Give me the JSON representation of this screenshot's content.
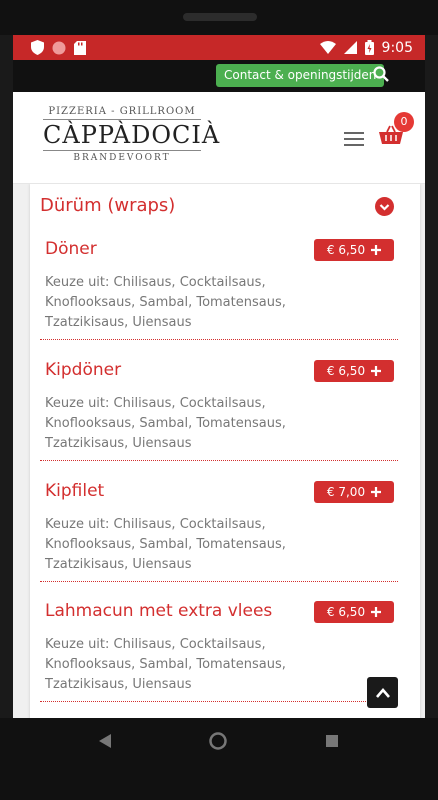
{
  "status_bar": {
    "time": "9:05"
  },
  "top_bar": {
    "contact_label": "Contact & openingstijden"
  },
  "logo": {
    "top": "PIZZERIA - GRILLROOM",
    "main": "CÀPPÀDOCIÀ",
    "bottom": "BRANDEVOORT"
  },
  "cart": {
    "count": "0"
  },
  "category": {
    "title": "Dürüm (wraps)"
  },
  "items": [
    {
      "name": "Döner",
      "price": "€ 6,50",
      "desc": "Keuze uit: Chilisaus, Cocktailsaus, Knoflooksaus, Sambal, Tomatensaus, Tzatzikisaus, Uiensaus"
    },
    {
      "name": "Kipdöner",
      "price": "€ 6,50",
      "desc": "Keuze uit: Chilisaus, Cocktailsaus, Knoflooksaus, Sambal, Tomatensaus, Tzatzikisaus, Uiensaus"
    },
    {
      "name": "Kipfilet",
      "price": "€ 7,00",
      "desc": "Keuze uit: Chilisaus, Cocktailsaus, Knoflooksaus, Sambal, Tomatensaus, Tzatzikisaus, Uiensaus"
    },
    {
      "name": "Lahmacun met extra vlees",
      "price": "€ 6,50",
      "desc": "Keuze uit: Chilisaus, Cocktailsaus, Knoflooksaus, Sambal, Tomatensaus, Tzatzikisaus, Uiensaus"
    }
  ],
  "colors": {
    "brand": "#d32f2f",
    "status_bar": "#c62828",
    "contact_button": "#4caf50"
  },
  "icons": [
    "shield-icon",
    "circle-icon",
    "sd-card-icon",
    "wifi-icon",
    "signal-icon",
    "battery-icon",
    "search-icon",
    "hamburger-icon",
    "basket-icon",
    "chevron-down-icon",
    "plus-icon",
    "chevron-up-icon",
    "back-icon",
    "home-icon",
    "recents-icon"
  ]
}
